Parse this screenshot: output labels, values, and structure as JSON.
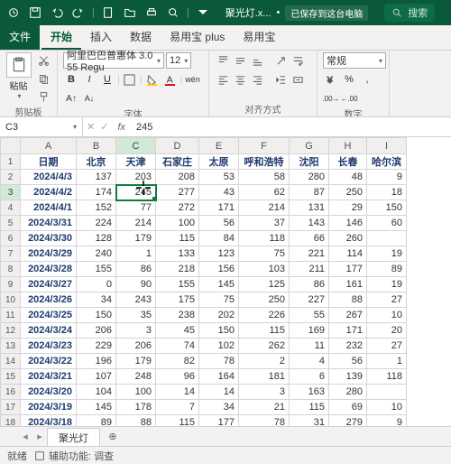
{
  "titlebar": {
    "filename": "聚光灯.x...",
    "saved": "已保存到这台电脑",
    "search": "搜索"
  },
  "tabs": [
    "文件",
    "开始",
    "插入",
    "数据",
    "易用宝 plus",
    "易用宝"
  ],
  "active_tab": "开始",
  "ribbon": {
    "clipboard": {
      "paste": "粘贴",
      "label": "剪贴板"
    },
    "font": {
      "name": "阿里巴巴普惠体 3.0 55 Regu",
      "size": "12",
      "label": "字体"
    },
    "align": {
      "label": "对齐方式"
    },
    "number": {
      "format": "常规",
      "label": "数字"
    }
  },
  "cellref": "C3",
  "formula": "245",
  "columns": [
    "A",
    "B",
    "C",
    "D",
    "E",
    "F",
    "G",
    "H",
    "I"
  ],
  "headers": [
    "日期",
    "北京",
    "天津",
    "石家庄",
    "太原",
    "呼和浩特",
    "沈阳",
    "长春",
    "哈尔滨"
  ],
  "rows": [
    {
      "n": 2,
      "d": "2024/4/3",
      "v": [
        137,
        203,
        208,
        53,
        58,
        280,
        48,
        "9"
      ]
    },
    {
      "n": 3,
      "d": "2024/4/2",
      "v": [
        174,
        "245",
        277,
        43,
        62,
        87,
        250,
        "18"
      ]
    },
    {
      "n": 4,
      "d": "2024/4/1",
      "v": [
        152,
        77,
        272,
        171,
        214,
        131,
        29,
        "150"
      ]
    },
    {
      "n": 5,
      "d": "2024/3/31",
      "v": [
        224,
        214,
        100,
        56,
        37,
        143,
        146,
        "60"
      ]
    },
    {
      "n": 6,
      "d": "2024/3/30",
      "v": [
        128,
        179,
        115,
        84,
        118,
        66,
        260,
        ""
      ]
    },
    {
      "n": 7,
      "d": "2024/3/29",
      "v": [
        240,
        1,
        133,
        123,
        75,
        221,
        114,
        "19"
      ]
    },
    {
      "n": 8,
      "d": "2024/3/28",
      "v": [
        155,
        86,
        218,
        156,
        103,
        211,
        177,
        "89"
      ]
    },
    {
      "n": 9,
      "d": "2024/3/27",
      "v": [
        0,
        90,
        155,
        145,
        125,
        86,
        161,
        "19"
      ]
    },
    {
      "n": 10,
      "d": "2024/3/26",
      "v": [
        34,
        243,
        175,
        75,
        250,
        227,
        88,
        "27"
      ]
    },
    {
      "n": 11,
      "d": "2024/3/25",
      "v": [
        150,
        35,
        238,
        202,
        226,
        55,
        267,
        "10"
      ]
    },
    {
      "n": 12,
      "d": "2024/3/24",
      "v": [
        206,
        3,
        45,
        150,
        115,
        169,
        171,
        "20"
      ]
    },
    {
      "n": 13,
      "d": "2024/3/23",
      "v": [
        229,
        206,
        74,
        102,
        262,
        11,
        232,
        "27"
      ]
    },
    {
      "n": 14,
      "d": "2024/3/22",
      "v": [
        196,
        179,
        82,
        78,
        2,
        4,
        56,
        "1"
      ]
    },
    {
      "n": 15,
      "d": "2024/3/21",
      "v": [
        107,
        248,
        96,
        164,
        181,
        6,
        139,
        "118"
      ]
    },
    {
      "n": 16,
      "d": "2024/3/20",
      "v": [
        104,
        100,
        14,
        14,
        3,
        163,
        280,
        ""
      ]
    },
    {
      "n": 17,
      "d": "2024/3/19",
      "v": [
        145,
        178,
        7,
        34,
        21,
        115,
        69,
        "10"
      ]
    },
    {
      "n": 18,
      "d": "2024/3/18",
      "v": [
        89,
        88,
        115,
        177,
        78,
        31,
        279,
        "9"
      ]
    }
  ],
  "sheet_tab": "聚光灯",
  "status": {
    "ready": "就绪",
    "acc": "辅助功能: 调查"
  }
}
